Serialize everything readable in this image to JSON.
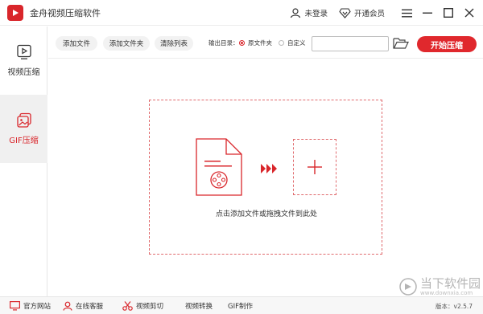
{
  "app": {
    "title": "金舟视频压缩软件"
  },
  "titlebar": {
    "login": "未登录",
    "vip": "开通会员"
  },
  "sidebar": {
    "items": [
      {
        "label": "视频压缩",
        "active": false
      },
      {
        "label": "GIF压缩",
        "active": true
      }
    ]
  },
  "toolbar": {
    "add_file": "添加文件",
    "add_folder": "添加文件夹",
    "clear_list": "清除列表",
    "output_label": "输出目录：",
    "radio_original": "原文件夹",
    "radio_custom": "自定义",
    "selected_radio": "原文件夹",
    "path_value": "",
    "start": "开始压缩"
  },
  "dropzone": {
    "hint": "点击添加文件或拖拽文件到此处"
  },
  "footer": {
    "website": "官方网站",
    "support": "在线客服",
    "video_cut": "视频剪切",
    "video_convert": "视频转换",
    "gif_make": "GIF制作",
    "version": "版本：v2.5.7"
  },
  "watermark": {
    "cn": "当下软件园",
    "en": "www.downxia.com"
  },
  "colors": {
    "accent": "#d9262b",
    "dashed": "#e06a6d"
  }
}
